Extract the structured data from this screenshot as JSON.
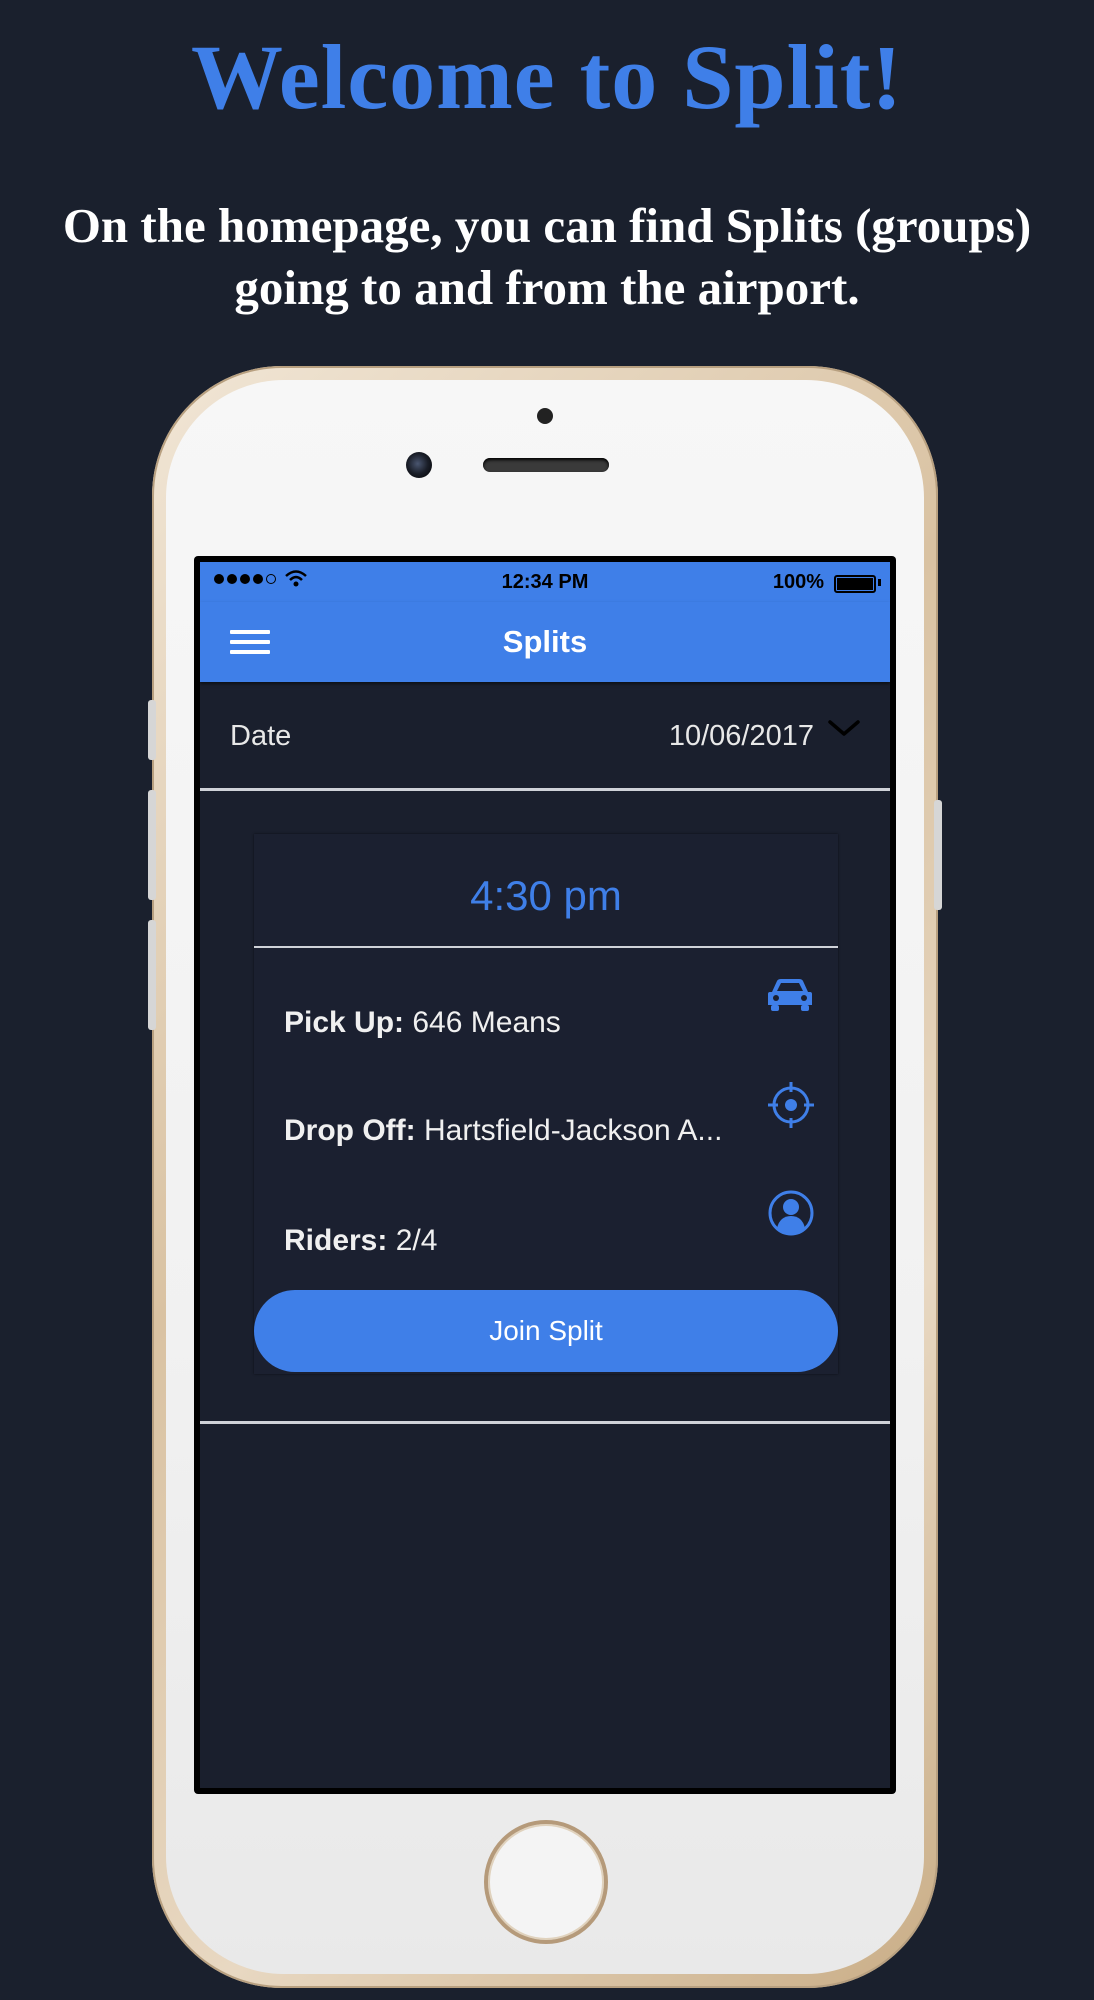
{
  "header": {
    "title": "Welcome to Split!",
    "subtitle_line1": "On the homepage, you can find Splits (groups)",
    "subtitle_line2": "going to and from the airport."
  },
  "status_bar": {
    "time": "12:34 PM",
    "battery": "100%"
  },
  "nav": {
    "title": "Splits",
    "menu_icon": "hamburger-menu-icon"
  },
  "date_filter": {
    "label": "Date",
    "value": "10/06/2017",
    "icon": "chevron-down-icon"
  },
  "split_card": {
    "time": "4:30 pm",
    "pickup_label": "Pick Up:",
    "pickup_value": "646 Means",
    "pickup_icon": "car-icon",
    "dropoff_label": "Drop Off:",
    "dropoff_value": "Hartsfield-Jackson A...",
    "dropoff_icon": "target-location-icon",
    "riders_label": "Riders:",
    "riders_value": "2/4",
    "riders_icon": "user-icon",
    "join_label": "Join Split"
  },
  "colors": {
    "accent": "#3f7fe8",
    "background": "#1a202d"
  }
}
